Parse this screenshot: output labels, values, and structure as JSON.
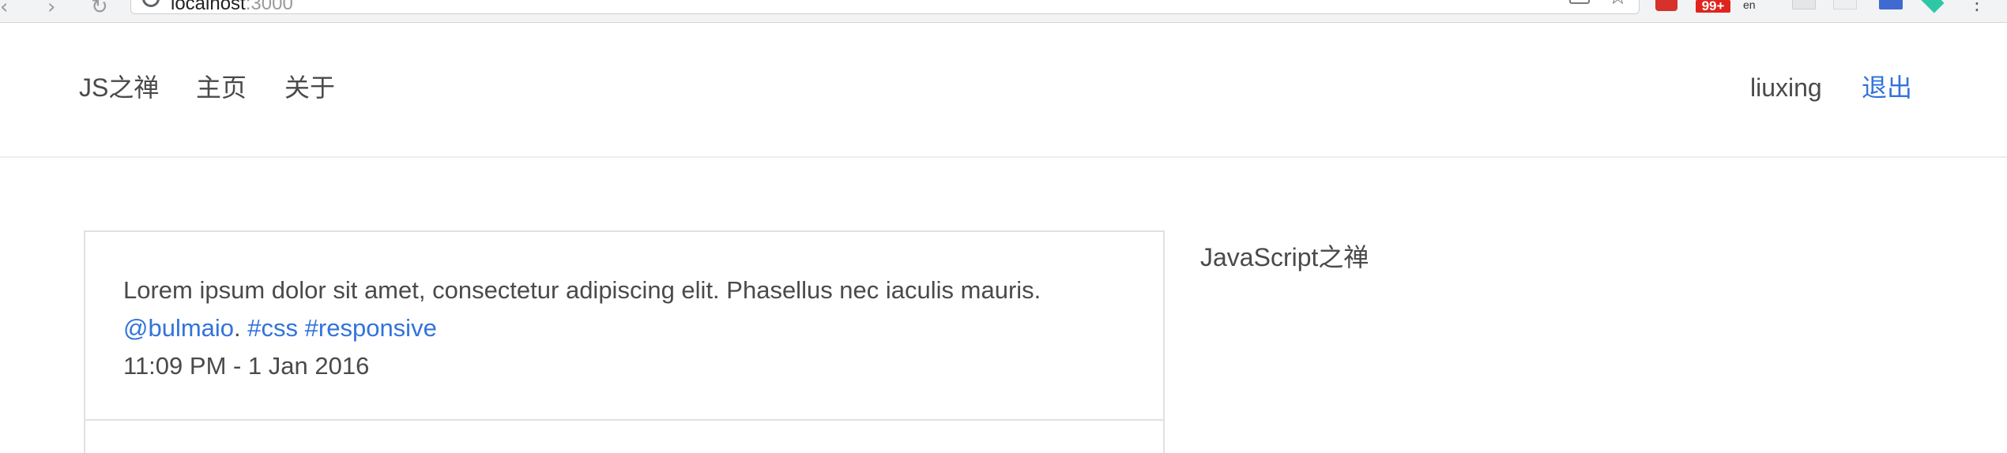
{
  "browser": {
    "url_host": "localhost",
    "url_port": ":3000",
    "extension_badge": "99+",
    "extension_lang": "en"
  },
  "navbar": {
    "brand": "JS之禅",
    "home": "主页",
    "about": "关于",
    "user": "liuxing",
    "logout": "退出"
  },
  "post": {
    "text": "Lorem ipsum dolor sit amet, consectetur adipiscing elit. Phasellus nec iaculis mauris.",
    "mention": "@bulmaio",
    "separator": ".",
    "tag1": "#css",
    "tag2": "#responsive",
    "timestamp": "11:09 PM - 1 Jan 2016"
  },
  "sidebar": {
    "title": "JavaScript之禅"
  },
  "colors": {
    "link": "#3273dc",
    "text": "#4a4a4a",
    "border": "#e1e1e1"
  }
}
